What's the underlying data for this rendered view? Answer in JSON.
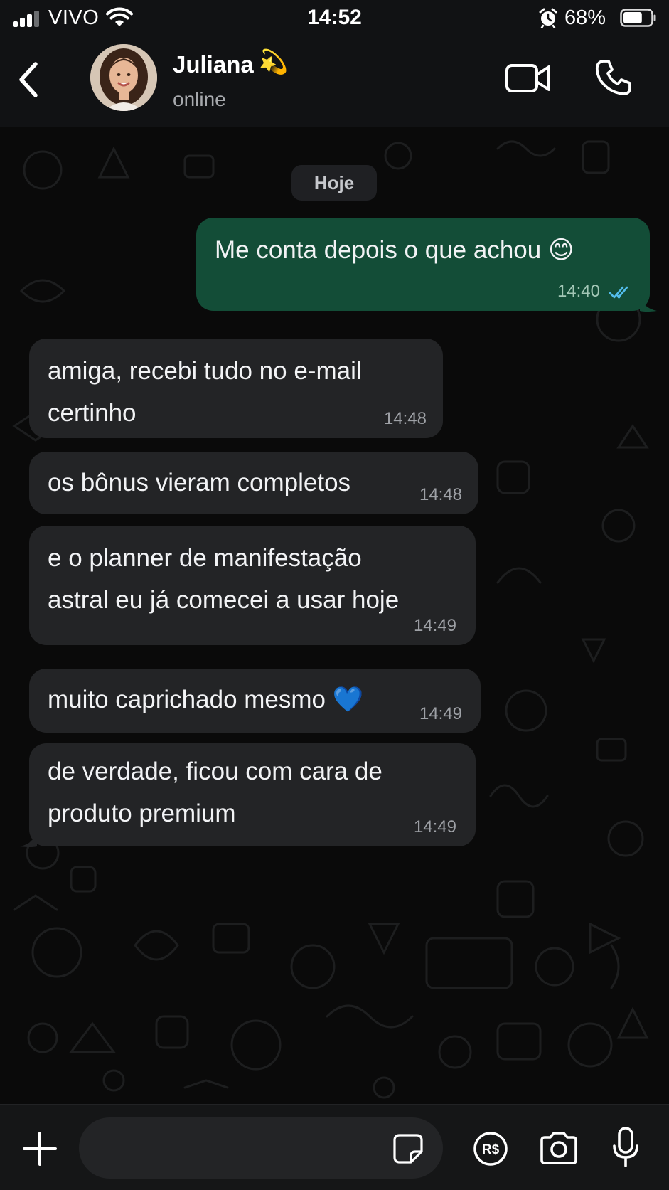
{
  "status_bar": {
    "carrier": "VIVO",
    "time": "14:52",
    "battery_percent": "68%",
    "battery_level": 0.68,
    "signal_bars": 3,
    "icons": [
      "signal-icon",
      "wifi-icon",
      "alarm-icon",
      "battery-icon"
    ]
  },
  "header": {
    "contact_name": "Juliana",
    "contact_name_emoji": "💫",
    "status": "online",
    "icons": [
      "back-icon",
      "avatar",
      "video-call-icon",
      "phone-icon"
    ]
  },
  "chat": {
    "date_separator": "Hoje",
    "messages": [
      {
        "direction": "outgoing",
        "text": "Me conta depois o que achou 😊",
        "time": "14:40",
        "read": true
      },
      {
        "direction": "incoming",
        "lines": [
          "amiga, recebi tudo no e-mail",
          "certinho"
        ],
        "time": "14:48"
      },
      {
        "direction": "incoming",
        "text": "os bônus vieram completos",
        "time": "14:48"
      },
      {
        "direction": "incoming",
        "lines": [
          "e o planner de manifestação",
          "astral eu já comecei a usar hoje"
        ],
        "time": "14:49"
      },
      {
        "direction": "incoming",
        "text": "muito caprichado mesmo 💙",
        "time": "14:49"
      },
      {
        "direction": "incoming",
        "lines": [
          "de verdade, ficou com cara de",
          "produto premium"
        ],
        "time": "14:49"
      }
    ]
  },
  "input_bar": {
    "message_value": "",
    "icons": [
      "plus-icon",
      "sticker-icon",
      "payment-icon",
      "camera-icon",
      "microphone-icon"
    ]
  },
  "colors": {
    "outgoing_bubble": "#134d37",
    "incoming_bubble": "#232426",
    "read_ticks": "#53bdeb",
    "background": "#0a0a0a"
  }
}
